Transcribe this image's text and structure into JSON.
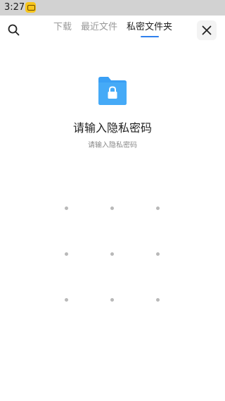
{
  "status_bar": {
    "time": "3:27",
    "app_icon": "yellow-app-notification-icon"
  },
  "header": {
    "search_icon": "search-icon",
    "tabs": [
      {
        "label": "下载",
        "active": false
      },
      {
        "label": "最近文件",
        "active": false
      },
      {
        "label": "私密文件夹",
        "active": true
      }
    ],
    "close_icon": "close-icon",
    "accent_color": "#2f80ed"
  },
  "lock": {
    "folder_icon": "lock-folder-icon",
    "folder_color": "#3aa0f5",
    "title": "请输入隐私密码",
    "subtitle": "请输入隐私密码"
  },
  "pattern": {
    "rows": 3,
    "cols": 3,
    "dot_color": "#b9b9b9"
  }
}
